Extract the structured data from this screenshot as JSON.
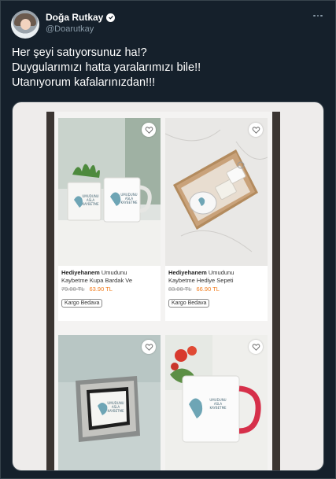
{
  "author": {
    "display_name": "Doğa Rutkay",
    "handle": "@Doarutkay",
    "verified": true
  },
  "tweet": {
    "lines": [
      "Her şeyi satıyorsunuz ha!?",
      "Duygularımızı hatta yaralarımızı bile!!",
      "Utanıyorum kafalarınızdan!!!"
    ]
  },
  "products": [
    {
      "brand": "Hediyehanem",
      "title_line1": " Umudunu",
      "title_line2": "Kaybetme Kupa Bardak Ve",
      "old_price": "79.00 TL",
      "new_price": "63.90 TL",
      "badge": "Kargo Bedava"
    },
    {
      "brand": "Hediyehanem",
      "title_line1": " Umudunu",
      "title_line2": "Kaybetme Hediye Sepeti",
      "old_price": "83.00 TL",
      "new_price": "66.90 TL",
      "badge": "Kargo Bedava"
    }
  ],
  "mug_print": {
    "line1": "UMUDUNU",
    "line2": "ASLA",
    "line3": "KAYBETME"
  },
  "colors": {
    "background": "#15202b",
    "secondary_text": "#8899a6",
    "price_accent": "#f27a1a",
    "mug_handle_red": "#d6304a"
  },
  "icons": {
    "verified": "verified-badge-icon",
    "more": "more-options-icon",
    "favorite": "heart-icon"
  }
}
